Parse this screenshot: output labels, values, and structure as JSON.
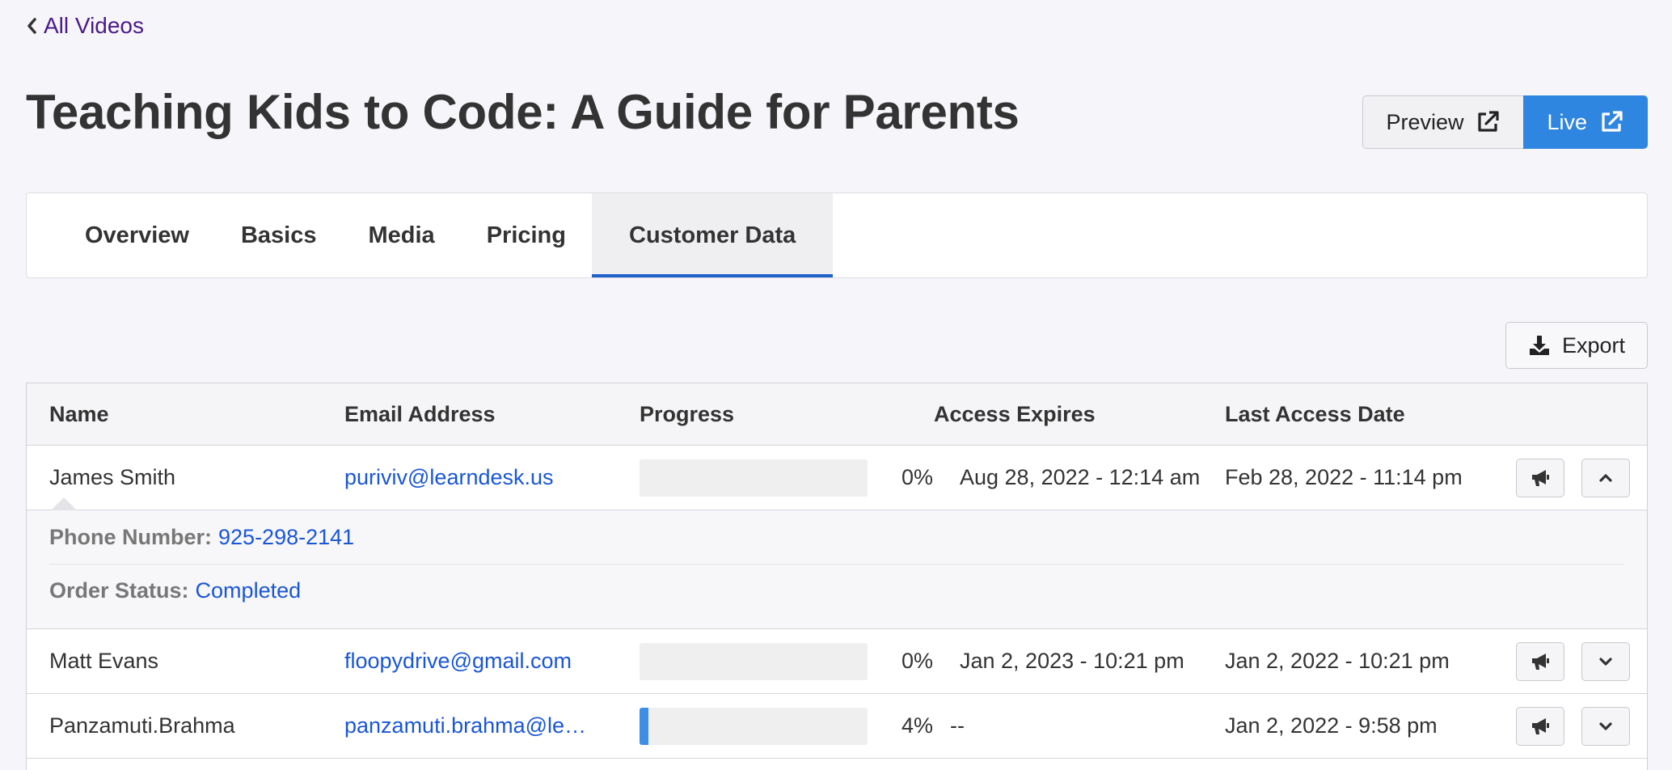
{
  "nav": {
    "back_label": "All Videos"
  },
  "page": {
    "title": "Teaching Kids to Code: A Guide for Parents"
  },
  "actions": {
    "preview_label": "Preview",
    "live_label": "Live",
    "export_label": "Export"
  },
  "tabs": [
    {
      "label": "Overview"
    },
    {
      "label": "Basics"
    },
    {
      "label": "Media"
    },
    {
      "label": "Pricing"
    },
    {
      "label": "Customer Data",
      "active": true
    }
  ],
  "table": {
    "columns": {
      "name": "Name",
      "email": "Email Address",
      "progress": "Progress",
      "expires": "Access Expires",
      "last_access": "Last Access Date"
    },
    "rows": [
      {
        "name": "James Smith",
        "email": "puriviv@learndesk.us",
        "progress": 0,
        "progress_label": "0%",
        "expires": "Aug 28, 2022 - 12:14 am",
        "last_access": "Feb 28, 2022 - 11:14 pm",
        "expanded": true,
        "details": {
          "phone_label": "Phone Number:",
          "phone": "925-298-2141",
          "status_label": "Order Status:",
          "status": "Completed"
        }
      },
      {
        "name": "Matt Evans",
        "email": "floopydrive@gmail.com",
        "progress": 0,
        "progress_label": "0%",
        "expires": "Jan 2, 2023 - 10:21 pm",
        "last_access": "Jan 2, 2022 - 10:21 pm",
        "expanded": false
      },
      {
        "name": "Panzamuti.Brahma",
        "email": "panzamuti.brahma@learndesk.us",
        "progress": 4,
        "progress_label": "4%",
        "expires": "--",
        "last_access": "Jan 2, 2022 - 9:58 pm",
        "expanded": false
      }
    ]
  },
  "icons": {
    "back": "chevron-left-icon",
    "external": "external-link-icon",
    "download": "download-icon",
    "announce": "megaphone-icon",
    "expand": "chevron-down-icon",
    "collapse": "chevron-up-icon"
  },
  "colors": {
    "accent": "#2f86e0",
    "link": "#1a56d6",
    "back_link": "#4a1a8a",
    "tab_indicator": "#1f63c9"
  }
}
